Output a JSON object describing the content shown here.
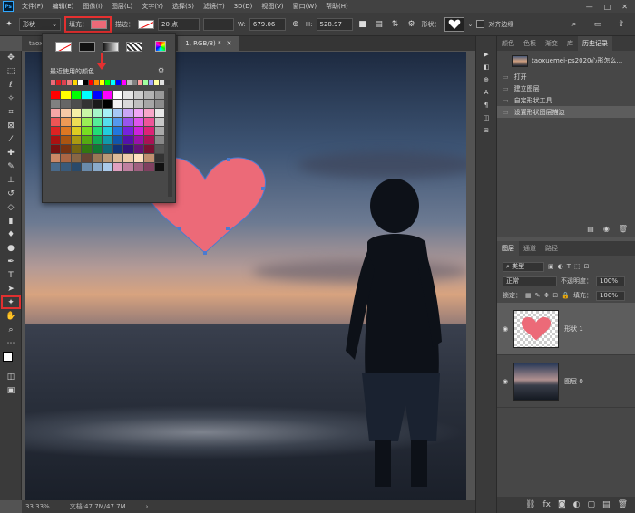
{
  "menubar": {
    "logo": "Ps",
    "items": [
      "文件(F)",
      "编辑(E)",
      "图像(I)",
      "图层(L)",
      "文字(Y)",
      "选择(S)",
      "滤镜(T)",
      "3D(D)",
      "视图(V)",
      "窗口(W)",
      "帮助(H)"
    ],
    "window_controls": [
      "—",
      "□",
      "✕"
    ]
  },
  "options_bar": {
    "mode": "形状",
    "fill_label": "填充：",
    "fill_color": "#ec6a78",
    "stroke_label": "描边：",
    "stroke_width": "20 点",
    "w_label": "W:",
    "w_value": "679.06",
    "h_label": "H:",
    "h_value": "528.97",
    "shape_label": "形状：",
    "align_edges": "对齐边缘"
  },
  "doc_tabs": [
    {
      "label": "taox",
      "active": false
    },
    {
      "label": "1, RGB/8) *",
      "active": true
    }
  ],
  "swatch_panel": {
    "recent_label": "最近使用的颜色",
    "recent_colors": [
      "#ec6a78",
      "#e02020",
      "#e04050",
      "#f08080",
      "#ffd700",
      "#ffffff",
      "#000000",
      "#ff0000",
      "#ff8c00",
      "#ffff00",
      "#00ff00",
      "#00ffff",
      "#0000ff",
      "#ff00ff",
      "#c0c0c0",
      "#808080",
      "#ffa0a0",
      "#a0ffa0",
      "#a0a0ff",
      "#ffffa0",
      "#e0e0e0",
      "#404040"
    ],
    "grid": [
      "#ff0000",
      "#ffff00",
      "#00ff00",
      "#00ffff",
      "#0000ff",
      "#ff00ff",
      "#ffffff",
      "#e6e6e6",
      "#cccccc",
      "#b3b3b3",
      "#999999",
      "#808080",
      "#666666",
      "#4d4d4d",
      "#333333",
      "#1a1a1a",
      "#000000",
      "#f2f2f2",
      "#d9d9d9",
      "#bfbfbf",
      "#a6a6a6",
      "#8c8c8c",
      "#f7a6a6",
      "#f7c9a6",
      "#f7f0a6",
      "#c9f7a6",
      "#a6f7c9",
      "#a6f0f7",
      "#a6c9f7",
      "#c9a6f7",
      "#f0a6f7",
      "#f7a6c9",
      "#e8e8e8",
      "#ee5555",
      "#ee9955",
      "#eedd55",
      "#99ee55",
      "#55ee99",
      "#55ddee",
      "#5599ee",
      "#9955ee",
      "#dd55ee",
      "#ee5599",
      "#c8c8c8",
      "#dd2222",
      "#dd7722",
      "#ddcc22",
      "#77dd22",
      "#22dd77",
      "#22ccdd",
      "#2277dd",
      "#7722dd",
      "#cc22dd",
      "#dd2277",
      "#aaaaaa",
      "#aa1111",
      "#aa5511",
      "#aa9911",
      "#55aa11",
      "#11aa55",
      "#1199aa",
      "#1155aa",
      "#5511aa",
      "#9911aa",
      "#aa1155",
      "#888888",
      "#771111",
      "#773311",
      "#776611",
      "#337711",
      "#117733",
      "#116677",
      "#113377",
      "#331177",
      "#661177",
      "#771133",
      "#555555",
      "#cc8866",
      "#aa6644",
      "#886644",
      "#664433",
      "#997755",
      "#bb9977",
      "#ddbb99",
      "#eeccaa",
      "#ffe0c0",
      "#c09070",
      "#333333",
      "#4a6a8a",
      "#3a5a7a",
      "#2a4a6a",
      "#6a8aaa",
      "#8aaaca",
      "#aacaea",
      "#e0a0c0",
      "#c080a0",
      "#a06080",
      "#804060",
      "#111111"
    ]
  },
  "tools": [
    "move",
    "marquee",
    "lasso",
    "magic-wand",
    "crop",
    "frame",
    "eyedropper",
    "healing",
    "brush",
    "stamp",
    "history-brush",
    "eraser",
    "gradient",
    "blur",
    "dodge",
    "pen",
    "type",
    "path-select",
    "custom-shape",
    "hand",
    "zoom",
    "more",
    "colors",
    "swap",
    "quickmask",
    "screen-mode"
  ],
  "right_strip_icons": [
    "▶",
    "◧",
    "⊕",
    "A",
    "¶",
    "◫",
    "⊞"
  ],
  "history": {
    "tabs": [
      "颜色",
      "色板",
      "渐变",
      "库",
      "历史记录"
    ],
    "snapshot": "taoxuemei-ps2020心形怎么...",
    "steps": [
      "打开",
      "建立图层",
      "自定形状工具",
      "设置形状图层描边"
    ]
  },
  "layers": {
    "tabs": [
      "图层",
      "通道",
      "路径"
    ],
    "filter_kind": "类型",
    "blend_mode": "正常",
    "opacity_label": "不透明度：",
    "opacity_value": "100%",
    "lock_label": "锁定：",
    "fill_label": "填充：",
    "fill_value": "100%",
    "items": [
      {
        "name": "形状 1",
        "active": true
      },
      {
        "name": "图层 0",
        "active": false
      }
    ],
    "footer_icons": [
      "⛓",
      "fx",
      "◙",
      "◐",
      "▢",
      "▤",
      "🗑"
    ]
  },
  "status": {
    "zoom": "33.33%",
    "doc_info": "文档:47.7M/47.7M"
  }
}
